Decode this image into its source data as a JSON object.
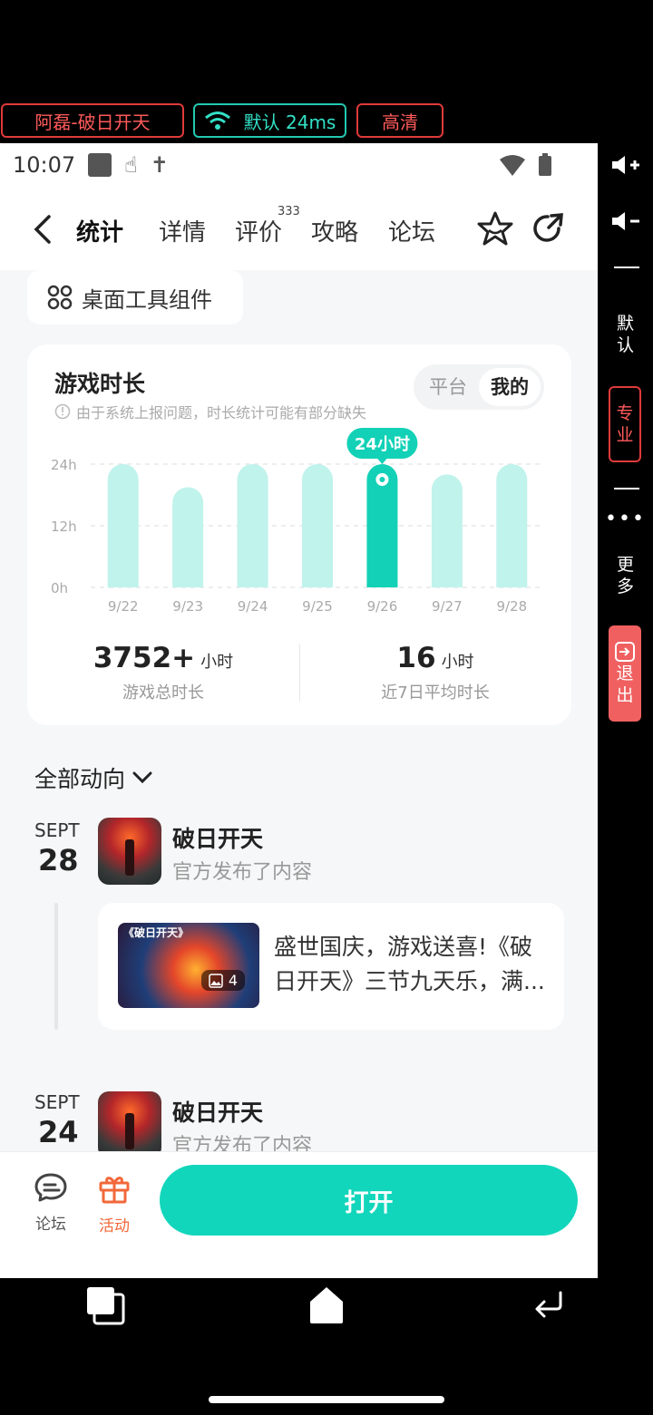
{
  "cloud_bar": {
    "game_label": "阿磊-破日开天",
    "network_label": "默认 24ms",
    "quality_label": "高清"
  },
  "status_bar": {
    "time": "10:07"
  },
  "nav": {
    "tabs": [
      "统计",
      "详情",
      "评价",
      "攻略",
      "论坛"
    ],
    "review_count": "333"
  },
  "tool_button": {
    "label": "桌面工具组件"
  },
  "playtime_card": {
    "title": "游戏时长",
    "note": "由于系统上报问题，时长统计可能有部分缺失",
    "segment": [
      "平台",
      "我的"
    ],
    "highlight_label": "24小时"
  },
  "chart_data": {
    "type": "bar",
    "categories": [
      "9/22",
      "9/23",
      "9/24",
      "9/25",
      "9/26",
      "9/27",
      "9/28"
    ],
    "values": [
      24,
      19.5,
      24,
      24,
      24,
      22,
      24
    ],
    "highlight_index": 4,
    "yticks": [
      "24h",
      "12h",
      "0h"
    ],
    "ylim": [
      0,
      24
    ],
    "grid": true,
    "bar_color": "#bff3ec",
    "highlight_color": "#12d1b6"
  },
  "stats": {
    "total": {
      "value": "3752+",
      "unit": "小时",
      "label": "游戏总时长"
    },
    "avg": {
      "value": "16",
      "unit": "小时",
      "label": "近7日平均时长"
    }
  },
  "feed": {
    "header": "全部动向",
    "entries": [
      {
        "month": "SEPT",
        "day": "28",
        "game": "破日开天",
        "action": "官方发布了内容",
        "post": {
          "thumb_title": "《破日开天》",
          "image_count": "4",
          "text": "盛世国庆，游戏送喜!《破日开天》三节九天乐，满..."
        }
      },
      {
        "month": "SEPT",
        "day": "24",
        "game": "破日开天",
        "action": "官方发布了内容"
      }
    ]
  },
  "bottom_bar": {
    "forum_label": "论坛",
    "events_label": "活动",
    "open_label": "打开"
  },
  "side_panel": {
    "default_label": "默认",
    "pro_label": "专业",
    "more_label": "更多",
    "exit_label": "退出"
  },
  "colors": {
    "accent": "#12d1b6",
    "events": "#f2683a",
    "cloud_red": "#e03a3a"
  }
}
